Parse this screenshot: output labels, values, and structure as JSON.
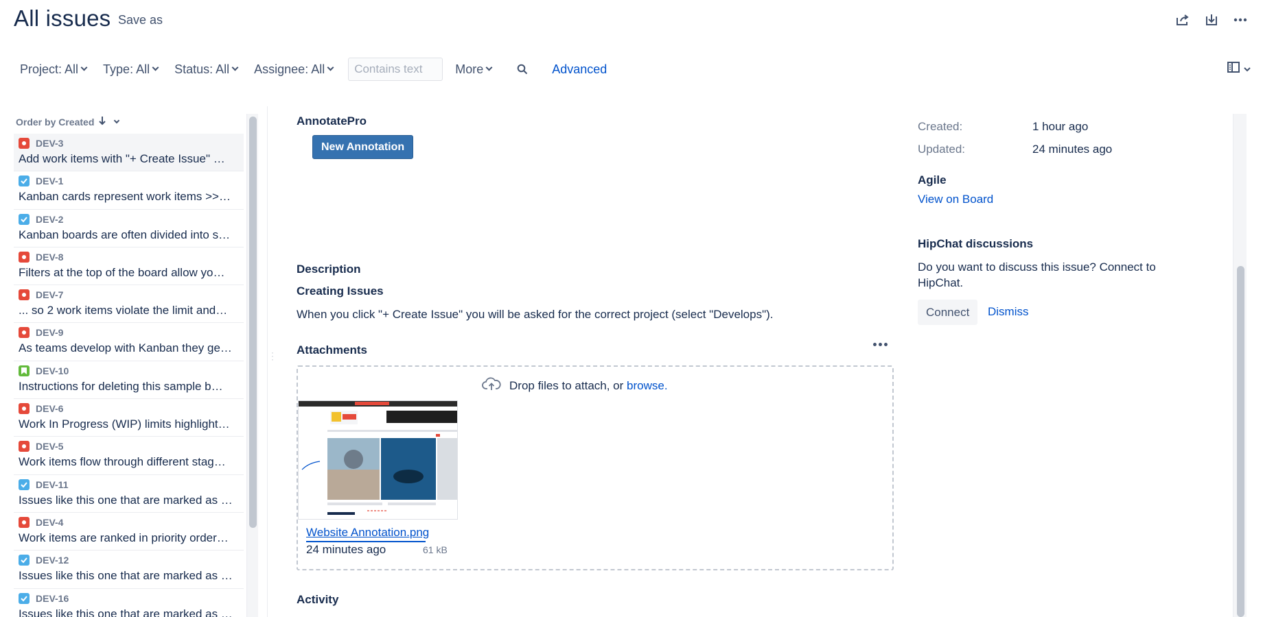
{
  "header": {
    "title": "All issues",
    "save_as": "Save as",
    "actions": [
      "share-icon",
      "export-icon",
      "more-icon"
    ]
  },
  "filters": {
    "project": "Project: All",
    "type": "Type: All",
    "status": "Status: All",
    "assignee": "Assignee: All",
    "text_placeholder": "Contains text",
    "more": "More",
    "advanced": "Advanced"
  },
  "list": {
    "order_by": "Order by Created",
    "issues": [
      {
        "key": "DEV-3",
        "type": "bug",
        "summary": "Add work items with \"+ Create Issue\" …",
        "selected": true
      },
      {
        "key": "DEV-1",
        "type": "task",
        "summary": "Kanban cards represent work items >>…"
      },
      {
        "key": "DEV-2",
        "type": "task",
        "summary": "Kanban boards are often divided into s…"
      },
      {
        "key": "DEV-8",
        "type": "bug",
        "summary": "Filters at the top of the board allow yo…"
      },
      {
        "key": "DEV-7",
        "type": "bug",
        "summary": "... so 2 work items violate the limit and…"
      },
      {
        "key": "DEV-9",
        "type": "bug",
        "summary": "As teams develop with Kanban they ge…"
      },
      {
        "key": "DEV-10",
        "type": "story",
        "summary": "Instructions for deleting this sample b…"
      },
      {
        "key": "DEV-6",
        "type": "bug",
        "summary": "Work In Progress (WIP) limits highlight…"
      },
      {
        "key": "DEV-5",
        "type": "bug",
        "summary": "Work items flow through different stag…"
      },
      {
        "key": "DEV-11",
        "type": "task",
        "summary": "Issues like this one that are marked as …"
      },
      {
        "key": "DEV-4",
        "type": "bug",
        "summary": "Work items are ranked in priority order…"
      },
      {
        "key": "DEV-12",
        "type": "task",
        "summary": "Issues like this one that are marked as …"
      },
      {
        "key": "DEV-16",
        "type": "task",
        "summary": "Issues like this one that are marked as …"
      }
    ]
  },
  "detail": {
    "plugin_title": "AnnotatePro",
    "new_annotation": "New Annotation",
    "description_label": "Description",
    "description_heading": "Creating Issues",
    "description_text": "When you click \"+ Create Issue\" you will be asked for the correct project (select \"Develops\").",
    "attachments_label": "Attachments",
    "drop_text": "Drop files to attach, or",
    "browse": "browse.",
    "attachment": {
      "name": "Website Annotation.png",
      "date": "24 minutes ago",
      "size": "61 kB"
    },
    "activity_label": "Activity"
  },
  "sidebar": {
    "created_label": "Created:",
    "created_value": "1 hour ago",
    "updated_label": "Updated:",
    "updated_value": "24 minutes ago",
    "agile_title": "Agile",
    "view_on_board": "View on Board",
    "hipchat_title": "HipChat discussions",
    "hipchat_text": "Do you want to discuss this issue? Connect to HipChat.",
    "connect": "Connect",
    "dismiss": "Dismiss"
  },
  "colors": {
    "link": "#0052cc",
    "bug": "#e5493a",
    "task": "#4bade8",
    "story": "#63ba3c",
    "primary_button": "#3572b0"
  }
}
